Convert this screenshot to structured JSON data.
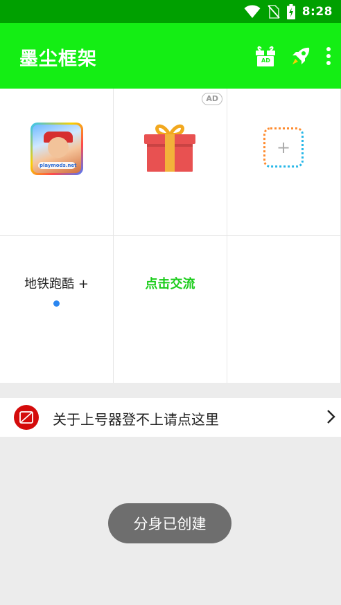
{
  "status_bar": {
    "time": "8:28",
    "icons": [
      "wifi-icon",
      "no-sim-icon",
      "battery-charging-icon"
    ]
  },
  "app_bar": {
    "title": "墨尘框架",
    "actions": [
      "gift-ad-icon",
      "rocket-icon",
      "more-vert-icon"
    ],
    "gift_badge": "AD"
  },
  "grid": {
    "items": [
      {
        "label": "地铁跑酷 +",
        "icon": "subway-surfers-app-icon",
        "icon_caption": "playmods.net",
        "running_indicator": true
      },
      {
        "label": "点击交流",
        "icon": "gift-box-icon",
        "badge": "AD"
      },
      {
        "label": "",
        "icon": "add-app-icon"
      }
    ]
  },
  "notice": {
    "text": "关于上号器登不上请点这里",
    "icon": "no-ad-icon",
    "arrow": "chevron-right-icon"
  },
  "toast": {
    "text": "分身已创建"
  },
  "colors": {
    "status_bar": "#00a000",
    "app_bar": "#14ee14",
    "accent_text": "#19cc19",
    "notice_icon": "#d40b0b",
    "indicator_dot": "#2a86f0"
  }
}
